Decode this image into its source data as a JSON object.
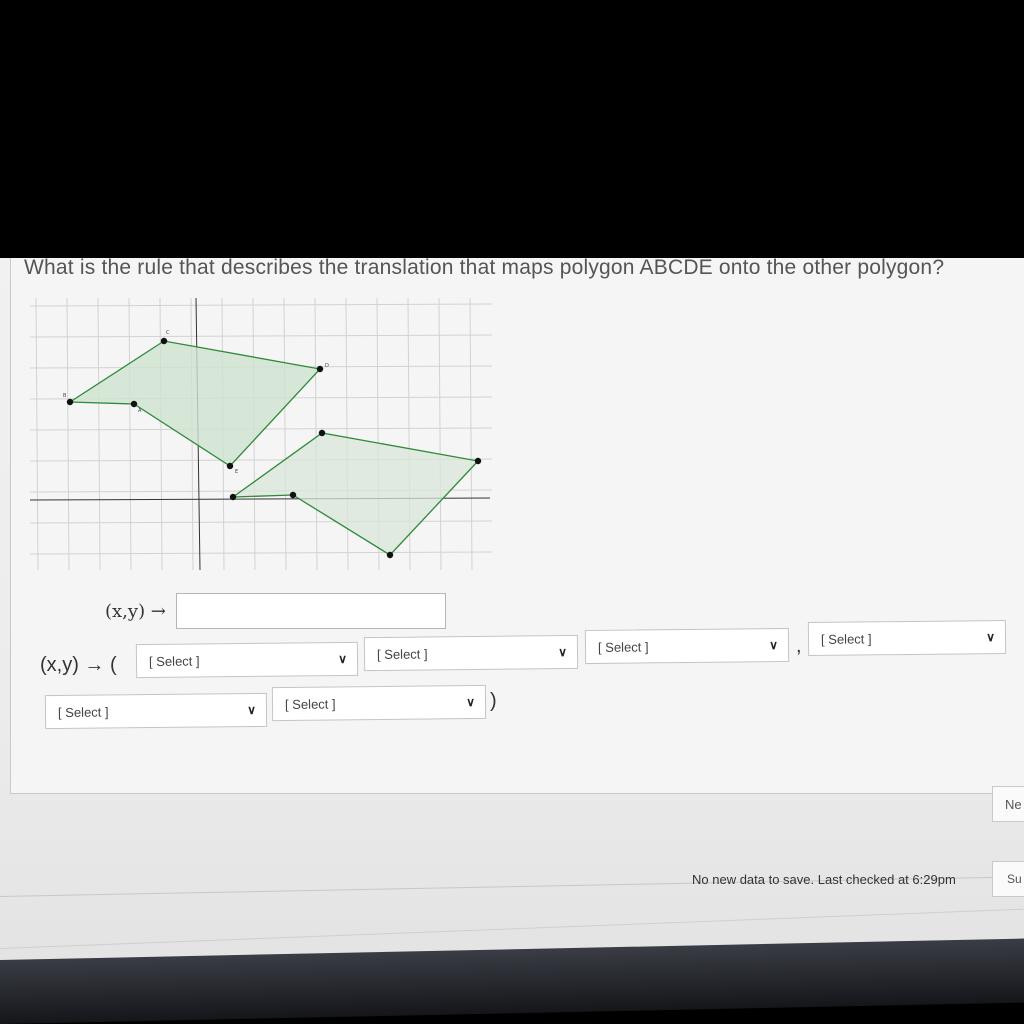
{
  "question": {
    "text": "What is the rule that describes the translation that maps polygon ABCDE onto the other polygon?"
  },
  "graph": {
    "point_labels": [
      "B",
      "A",
      "D",
      "E",
      "C"
    ],
    "colors": {
      "fill": "#cfe3cf",
      "stroke": "#2f8a3a",
      "point": "#111111",
      "grid": "#d2d2d2"
    }
  },
  "rule": {
    "label": "(x,y) →",
    "input_value": ""
  },
  "answer": {
    "prefix": "(x,y) → (",
    "comma": ",",
    "suffix": ")",
    "selects": [
      {
        "value": "[ Select ]"
      },
      {
        "value": "[ Select ]"
      },
      {
        "value": "[ Select ]"
      },
      {
        "value": "[ Select ]"
      },
      {
        "value": "[ Select ]"
      },
      {
        "value": "[ Select ]"
      }
    ]
  },
  "buttons": {
    "next": "Ne",
    "submit": "Su"
  },
  "status": {
    "text": "No new data to save. Last checked at 6:29pm"
  }
}
